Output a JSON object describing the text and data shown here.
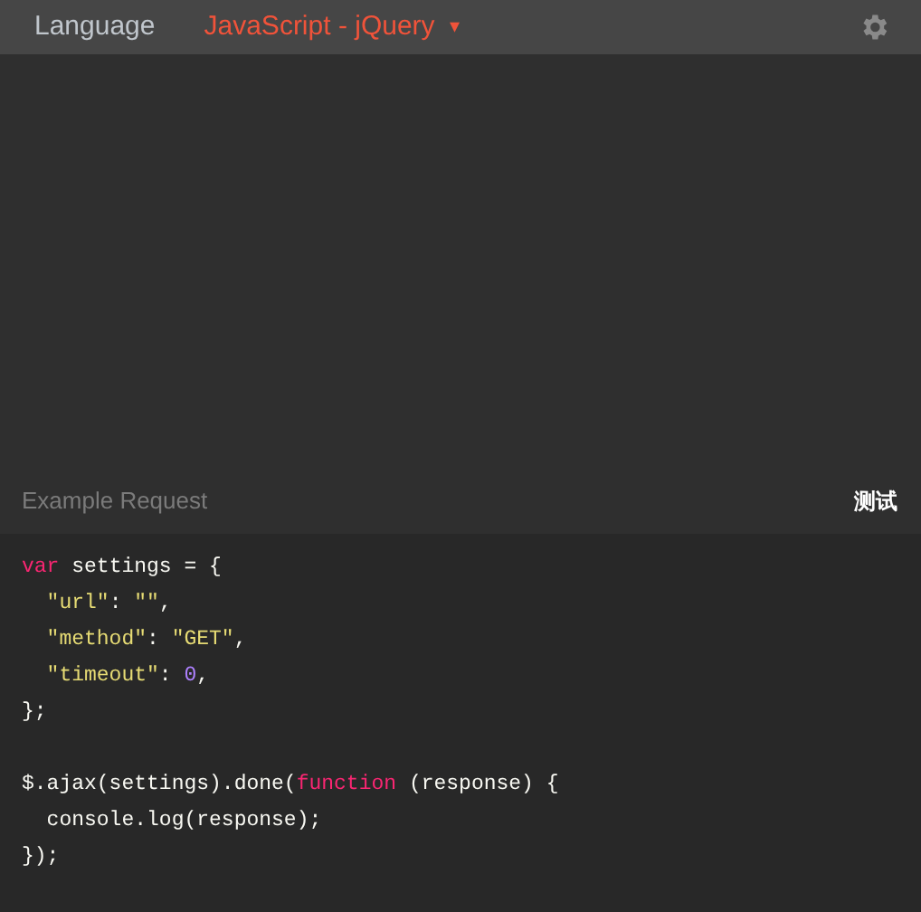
{
  "header": {
    "label": "Language",
    "language": "JavaScript - jQuery",
    "caret": "▾"
  },
  "request": {
    "title": "Example Request",
    "action": "测试"
  },
  "code_blocks": [
    [
      [
        {
          "text": "var",
          "kind": "keyword"
        },
        {
          "text": " settings = {",
          "kind": "plain"
        }
      ],
      [
        {
          "text": "  \"url\"",
          "kind": "string"
        },
        {
          "text": ": ",
          "kind": "plain"
        },
        {
          "text": "\"\"",
          "kind": "string"
        },
        {
          "text": ",",
          "kind": "plain"
        }
      ],
      [
        {
          "text": "  \"method\"",
          "kind": "string"
        },
        {
          "text": ": ",
          "kind": "plain"
        },
        {
          "text": "\"GET\"",
          "kind": "string"
        },
        {
          "text": ",",
          "kind": "plain"
        }
      ],
      [
        {
          "text": "  \"timeout\"",
          "kind": "string"
        },
        {
          "text": ": ",
          "kind": "plain"
        },
        {
          "text": "0",
          "kind": "number"
        },
        {
          "text": ",",
          "kind": "plain"
        }
      ],
      [
        {
          "text": "};",
          "kind": "plain"
        }
      ]
    ],
    [
      [
        {
          "text": "$.ajax(settings).done(",
          "kind": "plain"
        },
        {
          "text": "function",
          "kind": "keyword"
        },
        {
          "text": " (response) {",
          "kind": "plain"
        }
      ],
      [
        {
          "text": "  console.log(response);",
          "kind": "plain"
        }
      ],
      [
        {
          "text": "});",
          "kind": "plain"
        }
      ]
    ]
  ]
}
